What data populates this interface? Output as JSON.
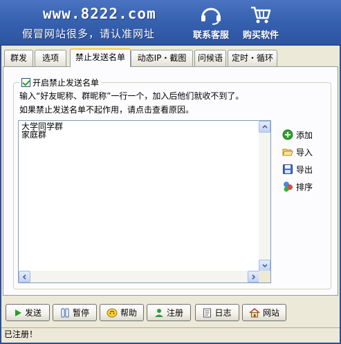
{
  "header": {
    "site_url": "www.8222.com",
    "slogan": "假冒网站很多，请认准网址",
    "service_label": "联系客服",
    "buy_label": "购买软件",
    "service_icon": "headset-icon",
    "buy_icon": "shopping-cart-icon"
  },
  "tabs": [
    {
      "label": "群发"
    },
    {
      "label": "选项"
    },
    {
      "label": "禁止发送名单"
    },
    {
      "label": "动态IP・截图"
    },
    {
      "label": "问候语"
    },
    {
      "label": "定时・循环"
    }
  ],
  "active_tab": "禁止发送名单",
  "blacklist": {
    "enable_label": "开启禁止发送名单",
    "enabled": true,
    "description_line1": "输入“好友昵称、群昵称”一行一个，加入后他们就收不到了。",
    "description_line2": "如果禁止发送名单不起作用，请点击查看原因。",
    "items": [
      "大学同学群",
      "家庭群"
    ],
    "actions": {
      "add": "添加",
      "import": "导入",
      "export": "导出",
      "sort": "排序"
    }
  },
  "toolbar": {
    "send": "发送",
    "pause": "暂停",
    "help": "帮助",
    "register": "注册",
    "log": "日志",
    "website": "网站"
  },
  "status": {
    "text": "已注册！"
  },
  "colors": {
    "header_blue": "#3762b0",
    "window_frame": "#2a4f96",
    "panel_bg": "#ece9d8",
    "active_tab_highlight": "#ffc83c"
  }
}
